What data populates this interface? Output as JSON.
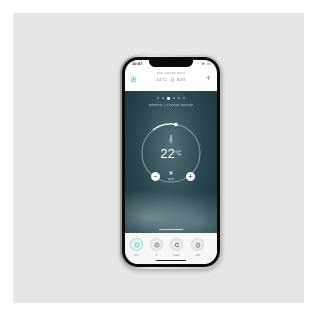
{
  "status_bar": {
    "time": "10:57",
    "icons": "·· ≋ ▭"
  },
  "header": {
    "location": "SAN FRANCISCO",
    "outdoor_temp": "13°C",
    "humidity": "82%"
  },
  "room": {
    "name": "NORTH | LIVING ROOM",
    "page_count": 6,
    "active_page": 2
  },
  "thermostat": {
    "temperature": "22",
    "unit": "°C",
    "fan_speed": "20%",
    "minus_label": "−",
    "plus_label": "+"
  },
  "modes": [
    {
      "label": "On",
      "icon": "power-icon"
    },
    {
      "label": "S",
      "icon": "fan-icon"
    },
    {
      "label": "Auto",
      "icon": "auto-icon"
    },
    {
      "label": "Off",
      "icon": "timer-icon"
    }
  ],
  "colors": {
    "accent": "#1cb5a6",
    "hero": "#2b4850"
  }
}
